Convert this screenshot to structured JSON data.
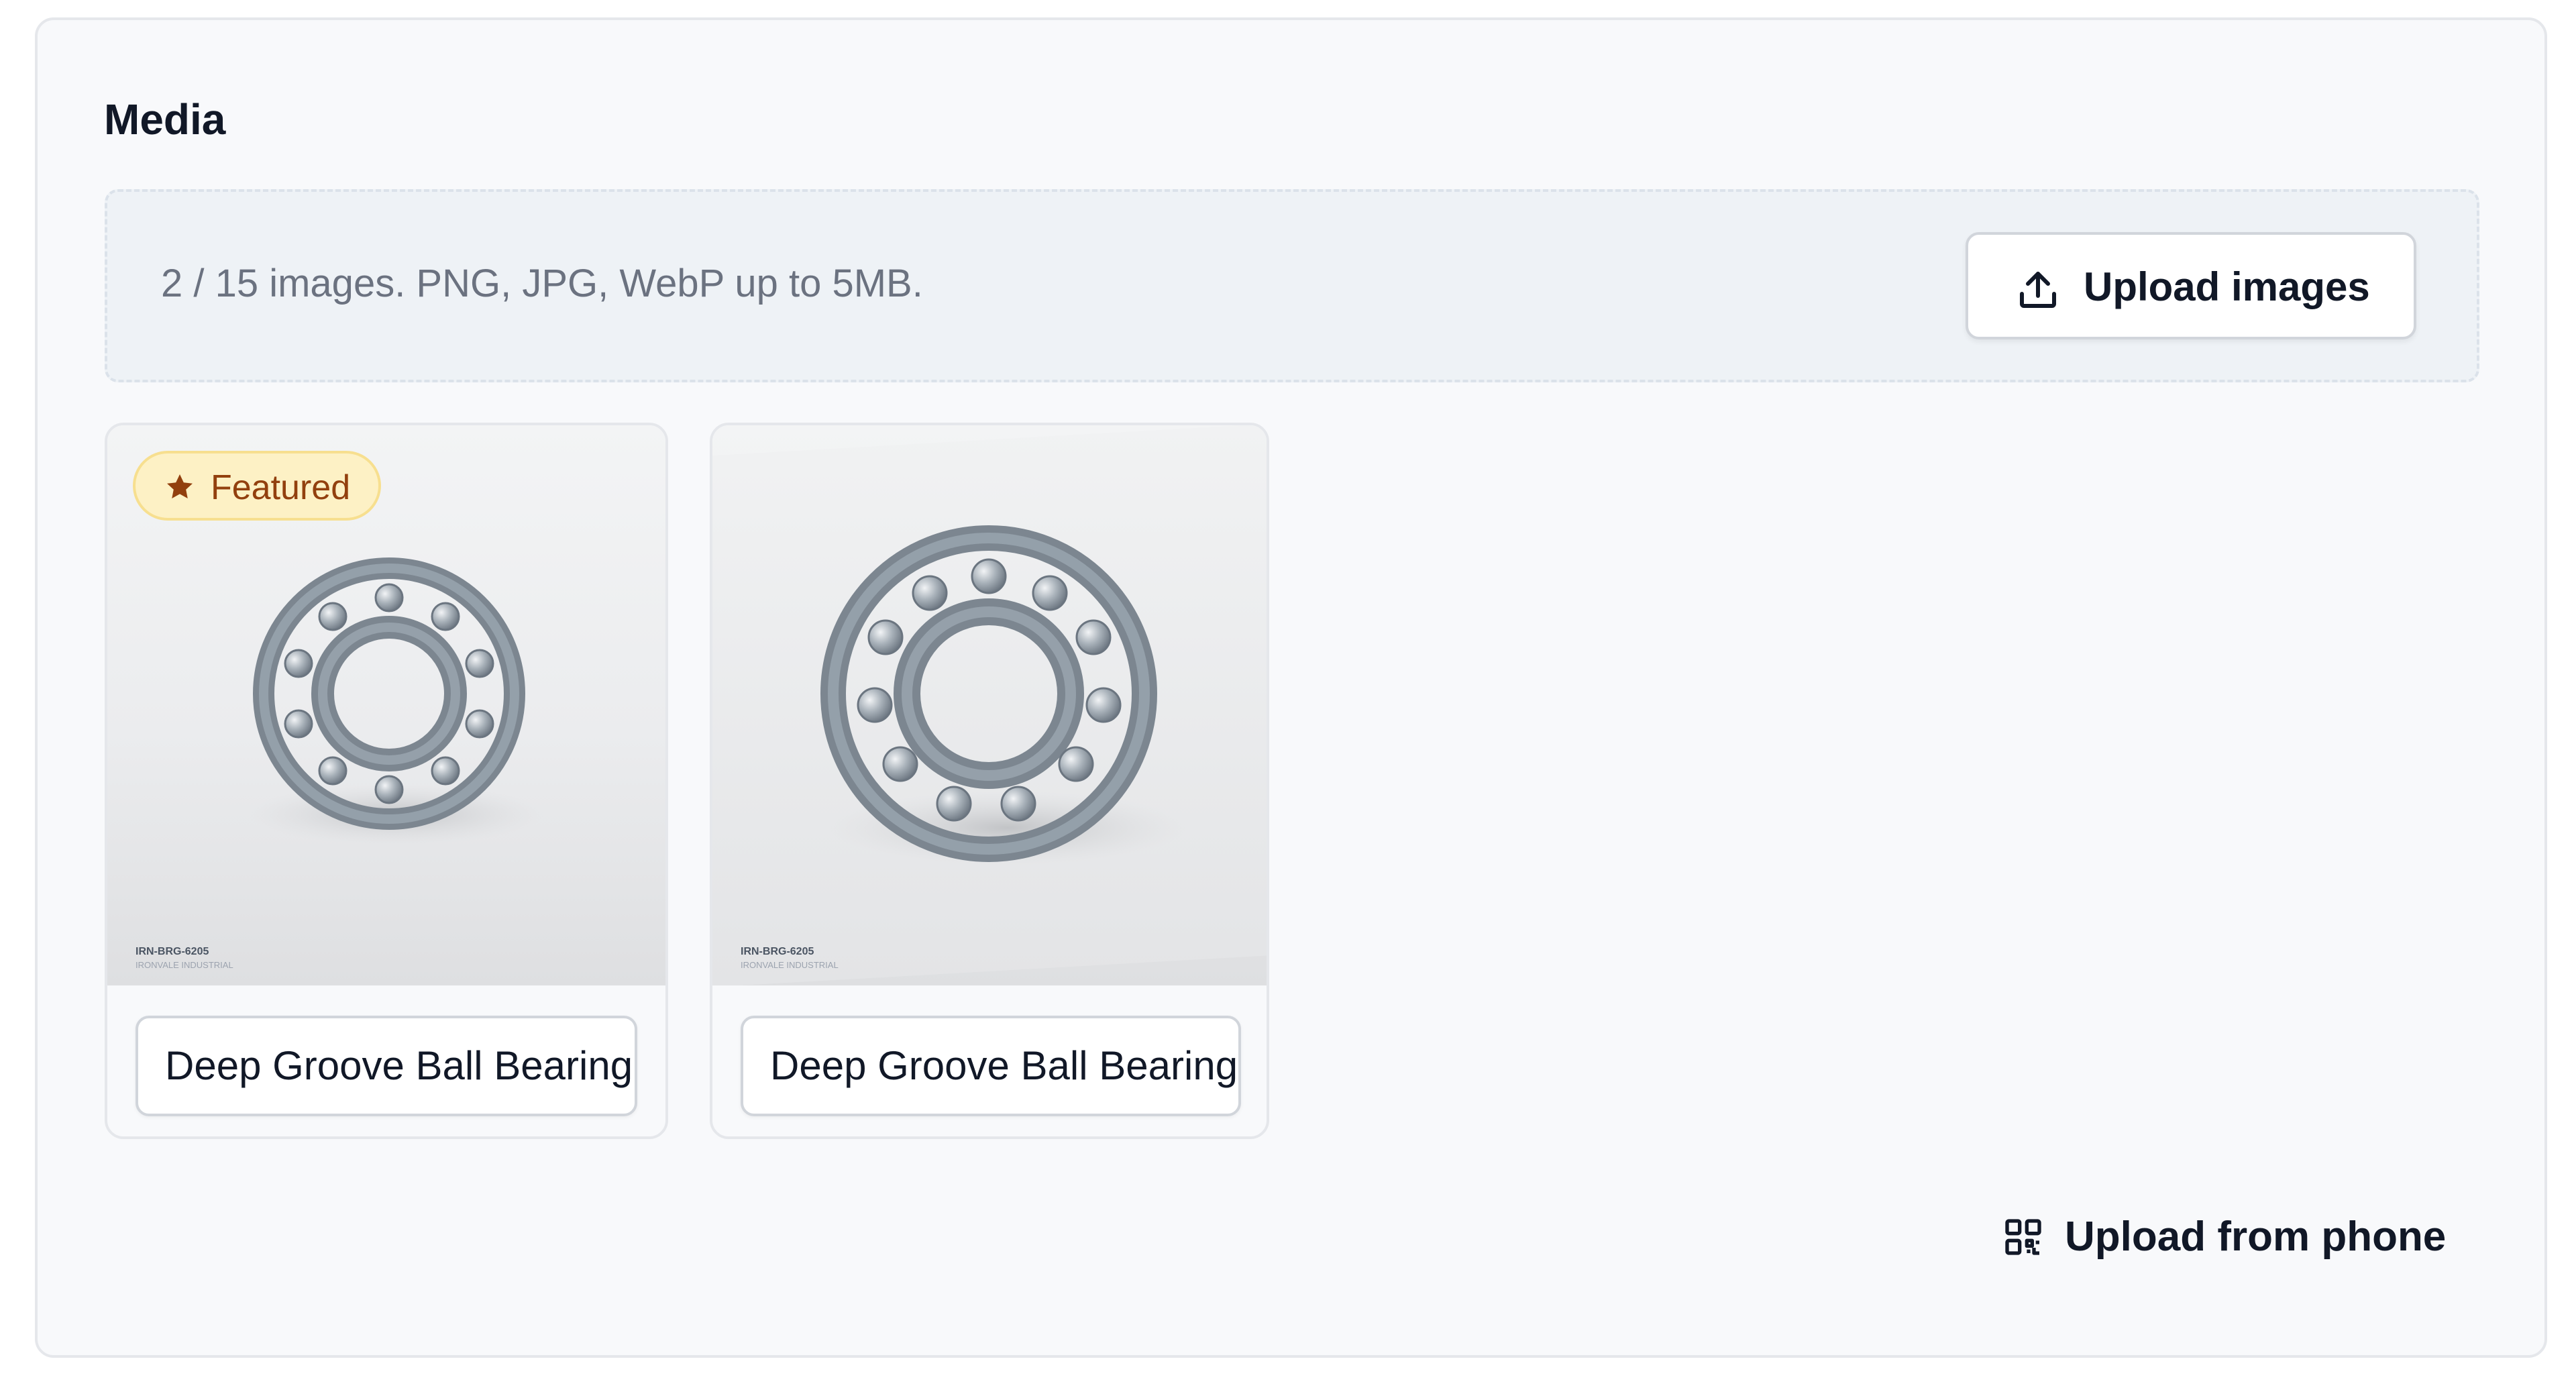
{
  "section": {
    "title": "Media"
  },
  "dropzone": {
    "info": "2 / 15 images. PNG, JPG, WebP up to 5MB.",
    "upload_label": "Upload images",
    "upload_icon": "upload-icon"
  },
  "images": [
    {
      "featured": true,
      "badge_label": "Featured",
      "badge_icon": "star-icon",
      "sku_text": "IRN-BRG-6205",
      "brand_text": "IRONVALE INDUSTRIAL",
      "alt_value": "Deep Groove Ball Bearing"
    },
    {
      "featured": false,
      "sku_text": "IRN-BRG-6205",
      "brand_text": "IRONVALE INDUSTRIAL",
      "alt_value": "Deep Groove Ball Bearing"
    }
  ],
  "phone_upload": {
    "label": "Upload from phone",
    "icon": "qr-code-icon"
  },
  "colors": {
    "panel_bg": "#f8f9fb",
    "dropzone_bg": "#eef2f6",
    "badge_bg": "#fdf1c5",
    "badge_text": "#92400e",
    "text_primary": "#111827",
    "text_muted": "#6b7280"
  }
}
